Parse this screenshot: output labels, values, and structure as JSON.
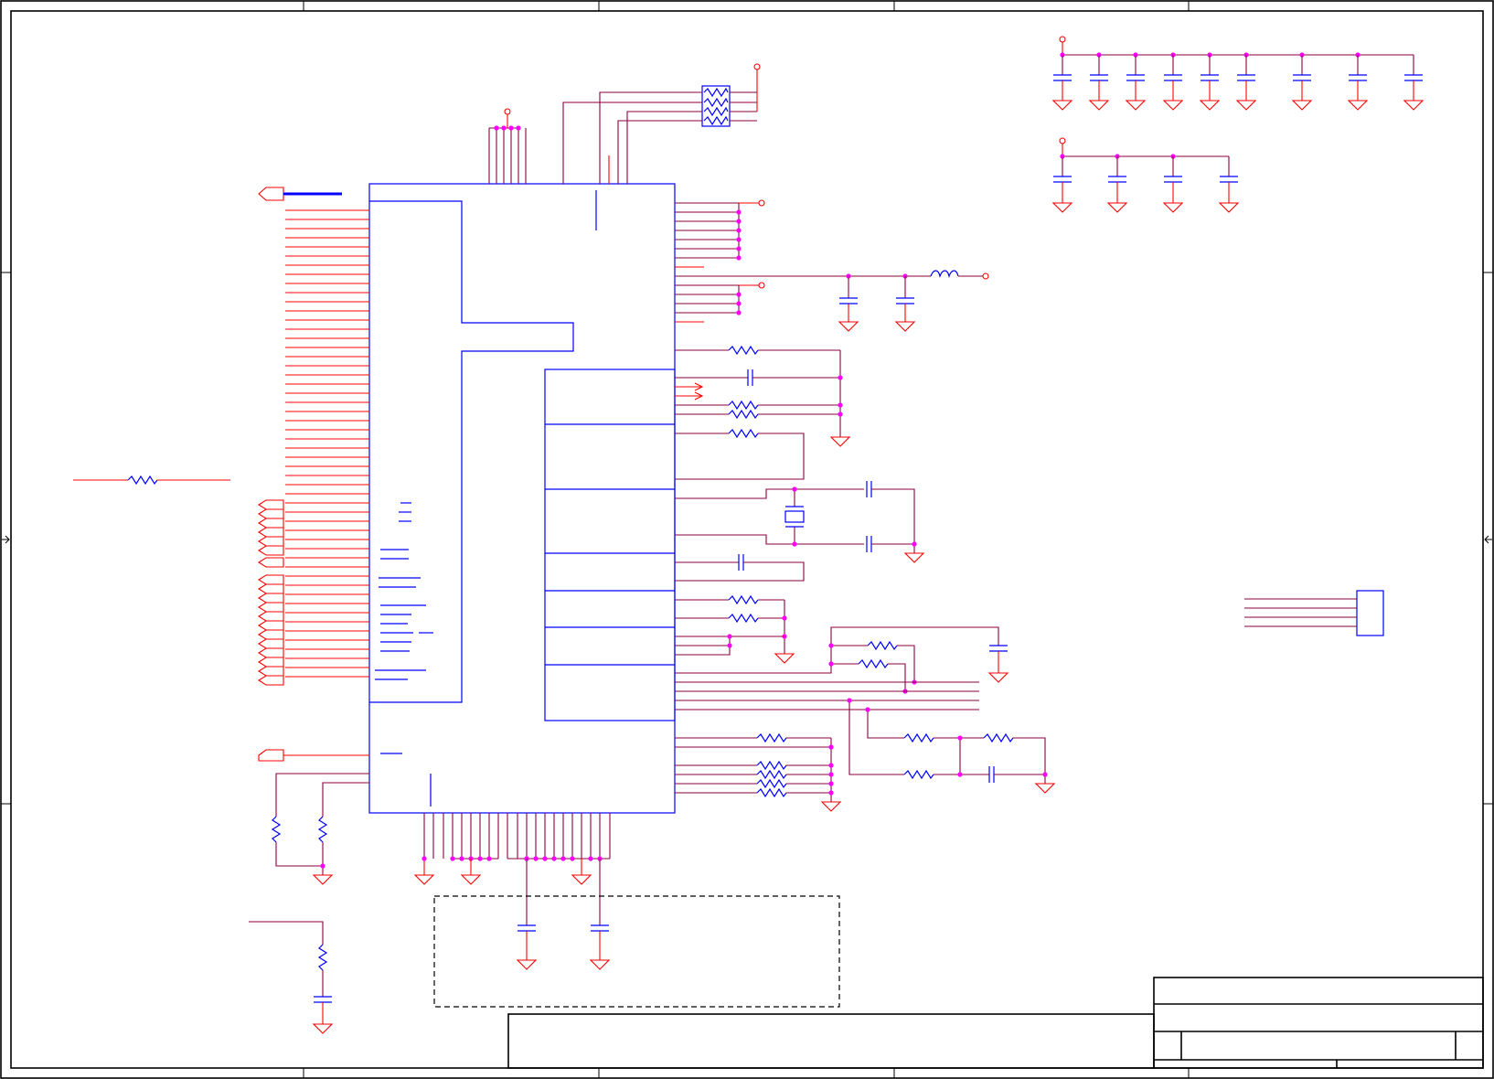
{
  "schematic": {
    "zones": {
      "columns": 5,
      "rows": 4
    },
    "colors": {
      "frame": "#000000",
      "component": "#0000ff",
      "wire": "#8b0040",
      "pin": "#ff0000",
      "junction": "#ff00ff"
    },
    "components": {
      "main_ic": "integrated-circuit",
      "resistor_array": "resistor-network",
      "decoupling_capacitors_row1": 9,
      "decoupling_capacitors_row2": 4,
      "crystal": "crystal-oscillator",
      "inductor": "ferrite-inductor",
      "connector": "header-connector"
    }
  }
}
